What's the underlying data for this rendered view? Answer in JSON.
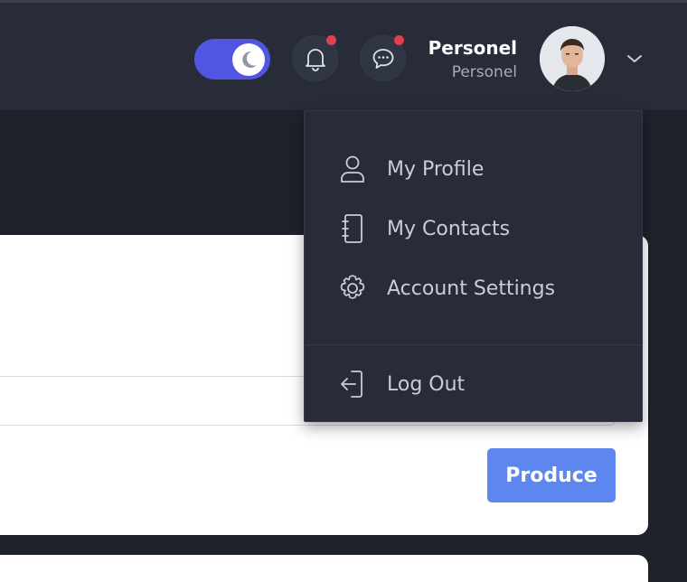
{
  "header": {
    "theme_toggle_state": "dark",
    "notifications_has_unread": true,
    "messages_has_unread": true,
    "user": {
      "name": "Personel",
      "role": "Personel"
    }
  },
  "user_menu": {
    "items": [
      {
        "label": "My Profile",
        "icon": "user-icon"
      },
      {
        "label": "My Contacts",
        "icon": "contacts-book-icon"
      },
      {
        "label": "Account Settings",
        "icon": "gear-icon"
      }
    ],
    "logout": {
      "label": "Log Out",
      "icon": "logout-icon"
    }
  },
  "form": {
    "submit_label": "Produce"
  },
  "colors": {
    "toggle": "#5156e2",
    "primary_button": "#5d86ee",
    "badge": "#e0404d",
    "topbar": "#272c38"
  }
}
